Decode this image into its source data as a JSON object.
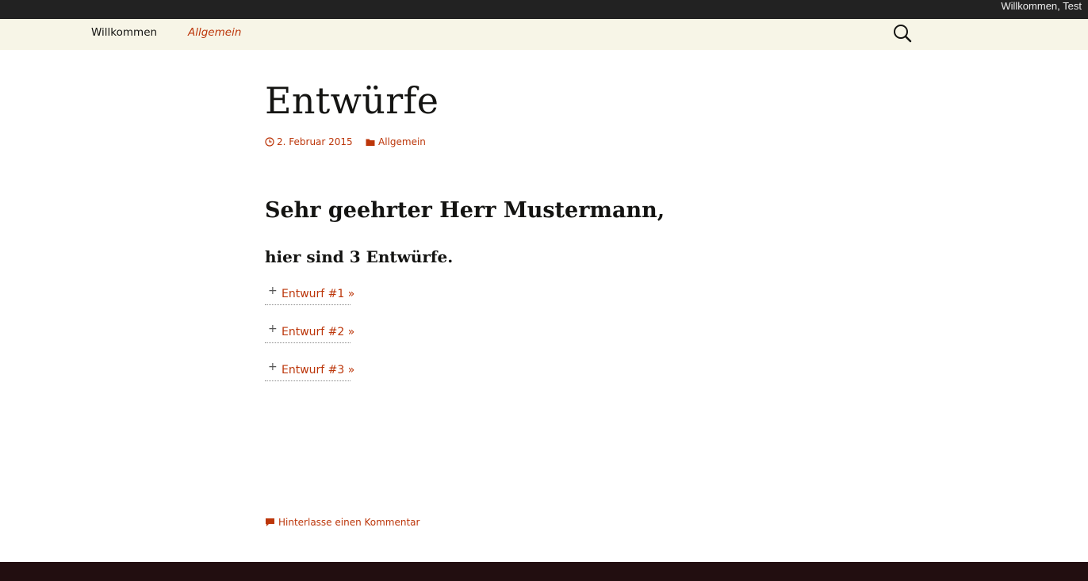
{
  "admin_bar": {
    "greeting": "Willkommen, Test"
  },
  "nav": {
    "items": [
      {
        "label": "Willkommen",
        "current": false
      },
      {
        "label": "Allgemein",
        "current": true
      }
    ],
    "search_icon": "search-icon"
  },
  "post": {
    "title": "Entwürfe",
    "date": "2. Februar 2015",
    "category": "Allgemein",
    "salutation": "Sehr geehrter Herr Mustermann,",
    "subheading": "hier sind 3 Entwürfe.",
    "drafts": [
      {
        "label": "Entwurf #1 »"
      },
      {
        "label": "Entwurf #2 »"
      },
      {
        "label": "Entwurf #3 »"
      }
    ],
    "comment_link": "Hinterlasse einen Kommentar"
  },
  "colors": {
    "accent": "#bc360a",
    "admin_bar": "#222222",
    "nav_bg": "#f7f5e7",
    "footer": "#220e10"
  }
}
